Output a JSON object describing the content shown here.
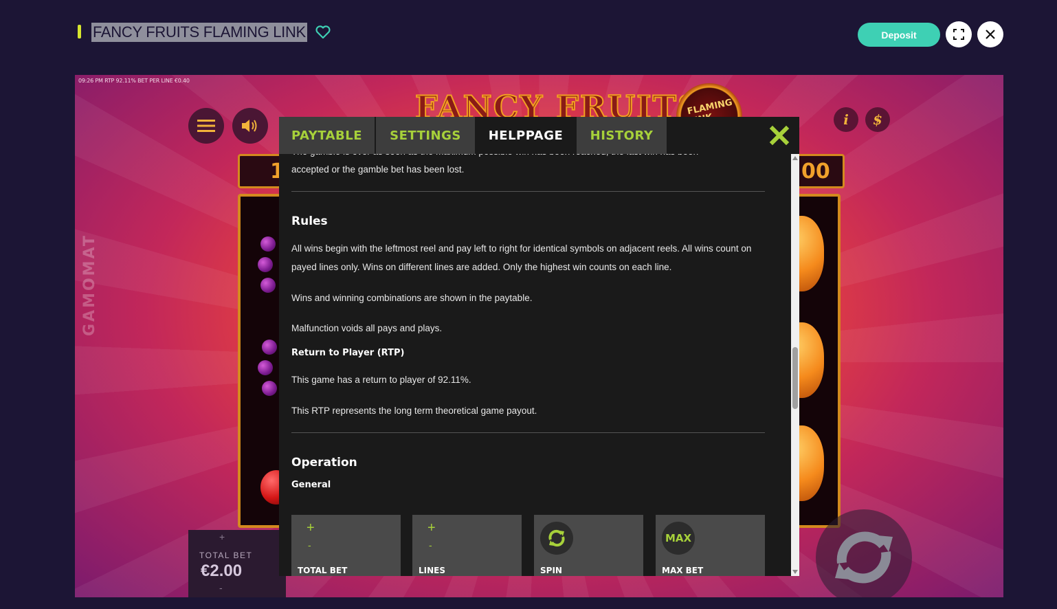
{
  "header": {
    "game_title": "FANCY FRUITS FLAMING LINK",
    "deposit_label": "Deposit",
    "accent_color": "#3ed0b4",
    "marker_color": "#d6e52e"
  },
  "game": {
    "stats_line": "09:26 PM  RTP 92.11%  BET PER LINE €0.40",
    "provider_watermark": "GAMOMAT",
    "logo_title": "FANCY FRUITS",
    "logo_badge": "FLAMING LINK",
    "left_box_partial": "1",
    "right_box_partial": "00",
    "info_btn": "i",
    "gamble_btn": "$",
    "total_bet_label": "TOTAL BET",
    "total_bet_value": "€2.00",
    "plus": "+",
    "minus": "-"
  },
  "modal": {
    "tabs": [
      {
        "label": "PAYTABLE",
        "active": false
      },
      {
        "label": "SETTINGS",
        "active": false
      },
      {
        "label": "HELPPAGE",
        "active": true
      },
      {
        "label": "HISTORY",
        "active": false
      }
    ],
    "accent_color": "#a7d13a",
    "content": {
      "cut_line": "The gamble is over as soon as the maximum possible win has been reached, the last win has been",
      "gamble_end": "accepted or the gamble bet has been lost.",
      "rules_heading": "Rules",
      "rules_p1": "All wins begin with the leftmost reel and pay left to right for identical symbols on adjacent reels. All wins count on payed lines only. Wins on different lines are added. Only the highest win counts on each line.",
      "rules_p2": "Wins and winning combinations are shown in the paytable.",
      "rules_p3": "Malfunction voids all pays and plays.",
      "rtp_heading": "Return to Player (RTP)",
      "rtp_p1": "This game has a return to player of 92.11%.",
      "rtp_p2": "This RTP represents the long term theoretical game payout.",
      "operation_heading": "Operation",
      "general_heading": "General",
      "cards": [
        {
          "label": "TOTAL BET",
          "plus": "+",
          "minus": "-"
        },
        {
          "label": "LINES",
          "plus": "+",
          "minus": "-"
        },
        {
          "label": "SPIN",
          "icon": "refresh-icon"
        },
        {
          "label": "MAX BET",
          "icon_text": "MAX"
        }
      ]
    }
  }
}
